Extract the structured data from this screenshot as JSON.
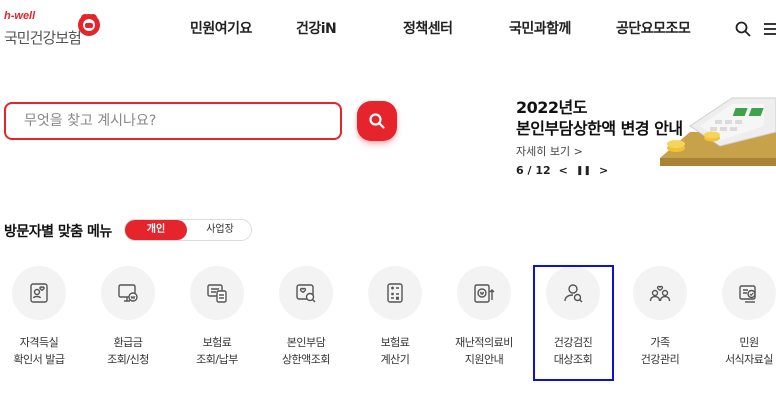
{
  "header": {
    "logo_small": "h-well",
    "logo_name": "국민건강보험",
    "nav": [
      "민원여기요",
      "건강iN",
      "정책센터",
      "국민과함께",
      "공단요모조모"
    ],
    "icons": [
      "search-icon",
      "menu-icon"
    ]
  },
  "search": {
    "placeholder": "무엇을 찾고 계시나요?",
    "icon": "search-icon",
    "accent": "#e5242b"
  },
  "banner": {
    "title_line1": "2022년도",
    "title_line2": "본인부담상한액 변경 안내",
    "more": "자세히 보기 >",
    "page": "6 / 12",
    "prev": "<",
    "pause": "❚❚",
    "next": ">"
  },
  "menu": {
    "title": "방문자별 맞춤 메뉴",
    "toggle_personal": "개인",
    "toggle_business": "사업장",
    "items": [
      {
        "line1": "자격득실",
        "line2": "확인서 발급",
        "icon": "certificate-icon"
      },
      {
        "line1": "환급금",
        "line2": "조회/신청",
        "icon": "refund-monitor-icon"
      },
      {
        "line1": "보험료",
        "line2": "조회/납부",
        "icon": "payment-icon"
      },
      {
        "line1": "본인부담",
        "line2": "상한액조회",
        "icon": "heart-search-icon"
      },
      {
        "line1": "보험료",
        "line2": "계산기",
        "icon": "calculator-icon"
      },
      {
        "line1": "재난적의료비",
        "line2": "지원안내",
        "icon": "medical-support-icon"
      },
      {
        "line1": "건강검진",
        "line2": "대상조회",
        "icon": "person-search-icon"
      },
      {
        "line1": "가족",
        "line2": "건강관리",
        "icon": "family-icon"
      },
      {
        "line1": "민원",
        "line2": "서식자료실",
        "icon": "form-document-icon"
      }
    ]
  }
}
